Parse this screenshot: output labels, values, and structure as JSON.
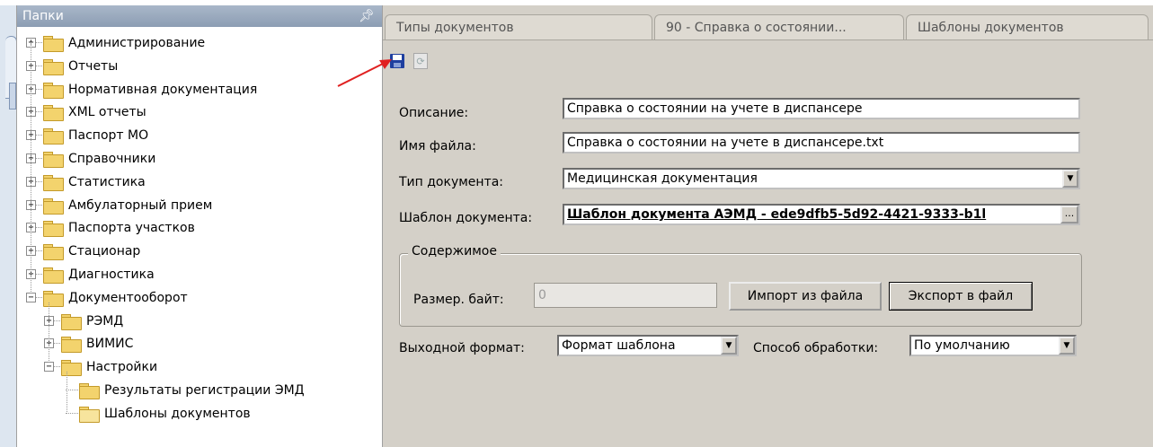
{
  "folders_panel": {
    "title": "Папки",
    "pin_icon": "pin-icon",
    "tree": [
      {
        "label": "Администрирование",
        "expander": "+"
      },
      {
        "label": "Отчеты",
        "expander": "+"
      },
      {
        "label": "Нормативная документация",
        "expander": "+"
      },
      {
        "label": "XML отчеты",
        "expander": "+"
      },
      {
        "label": "Паспорт МО",
        "expander": "+"
      },
      {
        "label": "Справочники",
        "expander": "+"
      },
      {
        "label": "Статистика",
        "expander": "+"
      },
      {
        "label": "Амбулаторный прием",
        "expander": "+"
      },
      {
        "label": "Паспорта участков",
        "expander": "+"
      },
      {
        "label": "Стационар",
        "expander": "+"
      },
      {
        "label": "Диагностика",
        "expander": "+"
      },
      {
        "label": "Документооборот",
        "expander": "−"
      },
      {
        "label": "РЭМД",
        "expander": "+"
      },
      {
        "label": "ВИМИС",
        "expander": "+"
      },
      {
        "label": "Настройки",
        "expander": "−"
      },
      {
        "label": "Результаты регистрации ЭМД",
        "expander": ""
      },
      {
        "label": "Шаблоны документов",
        "expander": ""
      }
    ]
  },
  "tabs": [
    {
      "label": "Типы документов"
    },
    {
      "label": "90 - Справка о состоянии..."
    },
    {
      "label": "Шаблоны документов"
    }
  ],
  "toolbar": {
    "save_icon": "save-icon",
    "refresh_icon": "refresh-icon",
    "refresh_glyph": "⟳"
  },
  "form": {
    "description_label": "Описание:",
    "description_value": "Справка о состоянии на учете в диспансере",
    "filename_label": "Имя файла:",
    "filename_value": "Справка о состоянии на учете в диспансере.txt",
    "doctype_label": "Тип документа:",
    "doctype_value": "Медицинская документация",
    "template_label": "Шаблон документа:",
    "template_value": "Шаблон документа АЭМД - ede9dfb5-5d92-4421-9333-b1l",
    "ellipsis": "...",
    "content_group_title": "Содержимое",
    "size_label": "Размер. байт:",
    "size_value": "0",
    "import_button": "Импорт из файла",
    "export_button": "Экспорт в файл",
    "output_format_label": "Выходной формат:",
    "output_format_value": "Формат шаблона",
    "processing_label": "Способ обработки:",
    "processing_value": "По умолчанию",
    "dropdown_glyph": "▼"
  },
  "colors": {
    "annotation_arrow": "#e02020",
    "panel_header": "#9aaac0",
    "panel_bg": "#d4d0c8"
  }
}
